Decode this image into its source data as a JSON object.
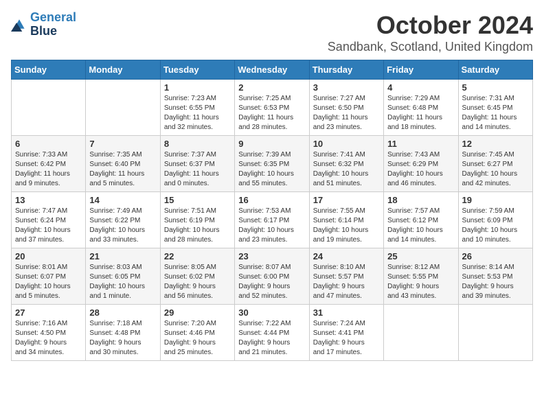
{
  "header": {
    "logo_line1": "General",
    "logo_line2": "Blue",
    "title": "October 2024",
    "subtitle": "Sandbank, Scotland, United Kingdom"
  },
  "days_of_week": [
    "Sunday",
    "Monday",
    "Tuesday",
    "Wednesday",
    "Thursday",
    "Friday",
    "Saturday"
  ],
  "weeks": [
    [
      {
        "day": "",
        "detail": ""
      },
      {
        "day": "",
        "detail": ""
      },
      {
        "day": "1",
        "detail": "Sunrise: 7:23 AM\nSunset: 6:55 PM\nDaylight: 11 hours\nand 32 minutes."
      },
      {
        "day": "2",
        "detail": "Sunrise: 7:25 AM\nSunset: 6:53 PM\nDaylight: 11 hours\nand 28 minutes."
      },
      {
        "day": "3",
        "detail": "Sunrise: 7:27 AM\nSunset: 6:50 PM\nDaylight: 11 hours\nand 23 minutes."
      },
      {
        "day": "4",
        "detail": "Sunrise: 7:29 AM\nSunset: 6:48 PM\nDaylight: 11 hours\nand 18 minutes."
      },
      {
        "day": "5",
        "detail": "Sunrise: 7:31 AM\nSunset: 6:45 PM\nDaylight: 11 hours\nand 14 minutes."
      }
    ],
    [
      {
        "day": "6",
        "detail": "Sunrise: 7:33 AM\nSunset: 6:42 PM\nDaylight: 11 hours\nand 9 minutes."
      },
      {
        "day": "7",
        "detail": "Sunrise: 7:35 AM\nSunset: 6:40 PM\nDaylight: 11 hours\nand 5 minutes."
      },
      {
        "day": "8",
        "detail": "Sunrise: 7:37 AM\nSunset: 6:37 PM\nDaylight: 11 hours\nand 0 minutes."
      },
      {
        "day": "9",
        "detail": "Sunrise: 7:39 AM\nSunset: 6:35 PM\nDaylight: 10 hours\nand 55 minutes."
      },
      {
        "day": "10",
        "detail": "Sunrise: 7:41 AM\nSunset: 6:32 PM\nDaylight: 10 hours\nand 51 minutes."
      },
      {
        "day": "11",
        "detail": "Sunrise: 7:43 AM\nSunset: 6:29 PM\nDaylight: 10 hours\nand 46 minutes."
      },
      {
        "day": "12",
        "detail": "Sunrise: 7:45 AM\nSunset: 6:27 PM\nDaylight: 10 hours\nand 42 minutes."
      }
    ],
    [
      {
        "day": "13",
        "detail": "Sunrise: 7:47 AM\nSunset: 6:24 PM\nDaylight: 10 hours\nand 37 minutes."
      },
      {
        "day": "14",
        "detail": "Sunrise: 7:49 AM\nSunset: 6:22 PM\nDaylight: 10 hours\nand 33 minutes."
      },
      {
        "day": "15",
        "detail": "Sunrise: 7:51 AM\nSunset: 6:19 PM\nDaylight: 10 hours\nand 28 minutes."
      },
      {
        "day": "16",
        "detail": "Sunrise: 7:53 AM\nSunset: 6:17 PM\nDaylight: 10 hours\nand 23 minutes."
      },
      {
        "day": "17",
        "detail": "Sunrise: 7:55 AM\nSunset: 6:14 PM\nDaylight: 10 hours\nand 19 minutes."
      },
      {
        "day": "18",
        "detail": "Sunrise: 7:57 AM\nSunset: 6:12 PM\nDaylight: 10 hours\nand 14 minutes."
      },
      {
        "day": "19",
        "detail": "Sunrise: 7:59 AM\nSunset: 6:09 PM\nDaylight: 10 hours\nand 10 minutes."
      }
    ],
    [
      {
        "day": "20",
        "detail": "Sunrise: 8:01 AM\nSunset: 6:07 PM\nDaylight: 10 hours\nand 5 minutes."
      },
      {
        "day": "21",
        "detail": "Sunrise: 8:03 AM\nSunset: 6:05 PM\nDaylight: 10 hours\nand 1 minute."
      },
      {
        "day": "22",
        "detail": "Sunrise: 8:05 AM\nSunset: 6:02 PM\nDaylight: 9 hours\nand 56 minutes."
      },
      {
        "day": "23",
        "detail": "Sunrise: 8:07 AM\nSunset: 6:00 PM\nDaylight: 9 hours\nand 52 minutes."
      },
      {
        "day": "24",
        "detail": "Sunrise: 8:10 AM\nSunset: 5:57 PM\nDaylight: 9 hours\nand 47 minutes."
      },
      {
        "day": "25",
        "detail": "Sunrise: 8:12 AM\nSunset: 5:55 PM\nDaylight: 9 hours\nand 43 minutes."
      },
      {
        "day": "26",
        "detail": "Sunrise: 8:14 AM\nSunset: 5:53 PM\nDaylight: 9 hours\nand 39 minutes."
      }
    ],
    [
      {
        "day": "27",
        "detail": "Sunrise: 7:16 AM\nSunset: 4:50 PM\nDaylight: 9 hours\nand 34 minutes."
      },
      {
        "day": "28",
        "detail": "Sunrise: 7:18 AM\nSunset: 4:48 PM\nDaylight: 9 hours\nand 30 minutes."
      },
      {
        "day": "29",
        "detail": "Sunrise: 7:20 AM\nSunset: 4:46 PM\nDaylight: 9 hours\nand 25 minutes."
      },
      {
        "day": "30",
        "detail": "Sunrise: 7:22 AM\nSunset: 4:44 PM\nDaylight: 9 hours\nand 21 minutes."
      },
      {
        "day": "31",
        "detail": "Sunrise: 7:24 AM\nSunset: 4:41 PM\nDaylight: 9 hours\nand 17 minutes."
      },
      {
        "day": "",
        "detail": ""
      },
      {
        "day": "",
        "detail": ""
      }
    ]
  ]
}
